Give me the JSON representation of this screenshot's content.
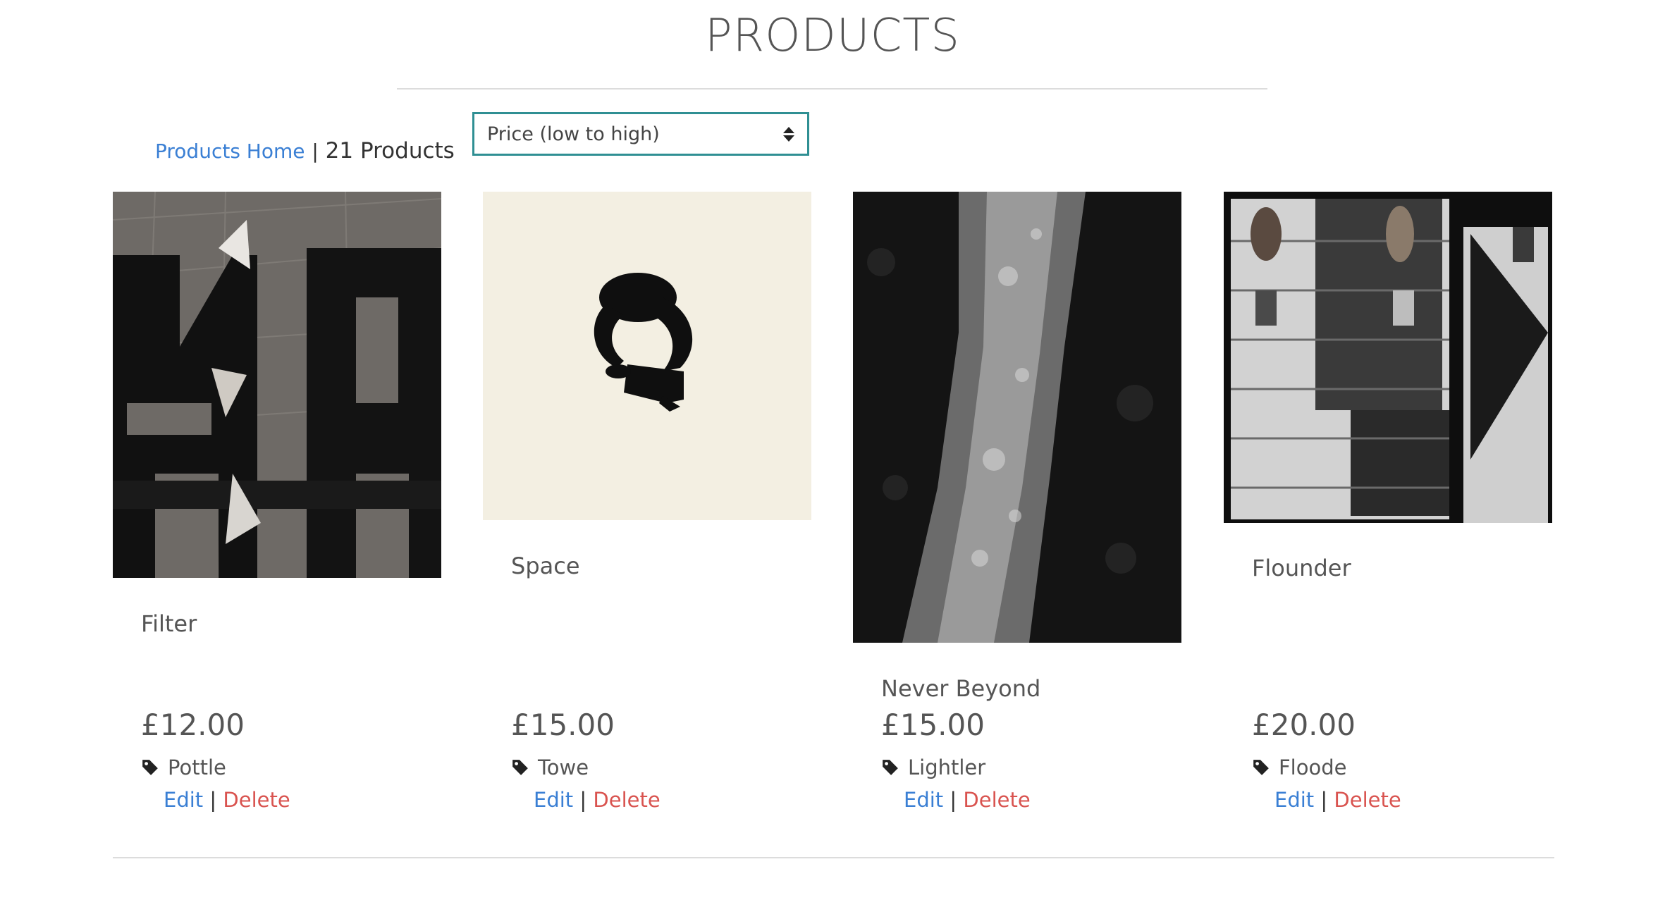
{
  "header": {
    "title": "PRODUCTS"
  },
  "toolbar": {
    "home_link": "Products Home",
    "separator": "|",
    "count_label": "21 Products",
    "sort_selected": "Price (low to high)"
  },
  "products": [
    {
      "name": "Filter",
      "price": "£12.00",
      "tag": "Pottle",
      "edit": "Edit",
      "sep": "|",
      "delete": "Delete"
    },
    {
      "name": "Space",
      "price": "£15.00",
      "tag": "Towe",
      "edit": "Edit",
      "sep": "|",
      "delete": "Delete"
    },
    {
      "name": "Never Beyond",
      "price": "£15.00",
      "tag": "Lightler",
      "edit": "Edit",
      "sep": "|",
      "delete": "Delete"
    },
    {
      "name": "Flounder",
      "price": "£20.00",
      "tag": "Floode",
      "edit": "Edit",
      "sep": "|",
      "delete": "Delete"
    }
  ],
  "colors": {
    "link": "#3a7fd4",
    "delete": "#d9534f",
    "select_border": "#2f8f93"
  },
  "icons": {
    "tag": "tag-icon",
    "sort": "sort-arrows-icon"
  }
}
